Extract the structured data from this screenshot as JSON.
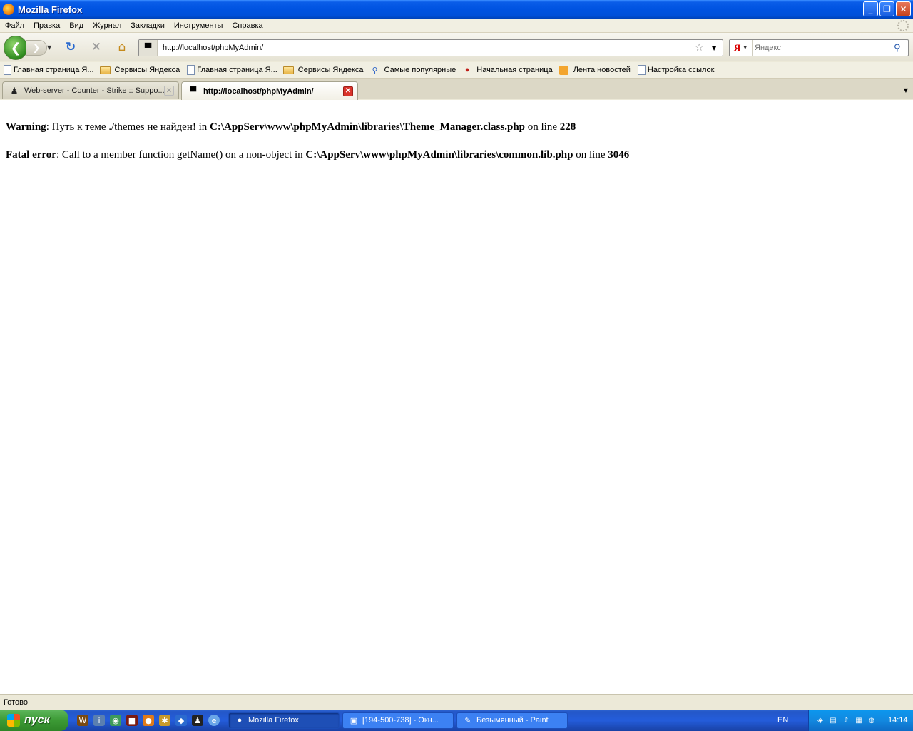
{
  "window": {
    "title": "Mozilla Firefox"
  },
  "menu": [
    "Файл",
    "Правка",
    "Вид",
    "Журнал",
    "Закладки",
    "Инструменты",
    "Справка"
  ],
  "navbar": {
    "url": "http://localhost/phpMyAdmin/",
    "search_placeholder": "Яндекс",
    "search_engine_letter": "Я"
  },
  "bookmarks": [
    {
      "label": "Главная страница Я...",
      "icon": "page-icon"
    },
    {
      "label": "Сервисы Яндекса",
      "icon": "folder-icon"
    },
    {
      "label": "Главная страница Я...",
      "icon": "page-icon"
    },
    {
      "label": "Сервисы Яндекса",
      "icon": "folder-icon"
    },
    {
      "label": "Самые популярные",
      "icon": "search-icon"
    },
    {
      "label": "Начальная страница",
      "icon": "red-logo-icon"
    },
    {
      "label": "Лента новостей",
      "icon": "rss-icon"
    },
    {
      "label": "Настройка ссылок",
      "icon": "page-icon"
    }
  ],
  "tabs": [
    {
      "label": "Web-server - Counter - Strike :: Suppo...",
      "active": false
    },
    {
      "label": "http://localhost/phpMyAdmin/",
      "active": true
    }
  ],
  "content": {
    "warning": {
      "label": "Warning",
      "message": ": Путь к теме ./themes не найден! in ",
      "file": "C:\\AppServ\\www\\phpMyAdmin\\libraries\\Theme_Manager.class.php",
      "on_line": " on line ",
      "line": "228"
    },
    "fatal": {
      "label": "Fatal error",
      "message": ": Call to a member function getName() on a non-object in ",
      "file": "C:\\AppServ\\www\\phpMyAdmin\\libraries\\common.lib.php",
      "on_line": " on line ",
      "line": "3046"
    }
  },
  "status": "Готово",
  "taskbar": {
    "start_label": "пуск",
    "tasks": [
      {
        "label": "Mozilla Firefox",
        "active": true
      },
      {
        "label": "[194-500-738] - Окн...",
        "active": false
      },
      {
        "label": "Безымянный - Paint",
        "active": false
      }
    ],
    "language": "EN",
    "clock": "14:14"
  },
  "colors": {
    "taskbar": "#245DDB",
    "titlebar": "#0053E1",
    "start": "#3C9A35",
    "tab_close": "#D9342B"
  }
}
